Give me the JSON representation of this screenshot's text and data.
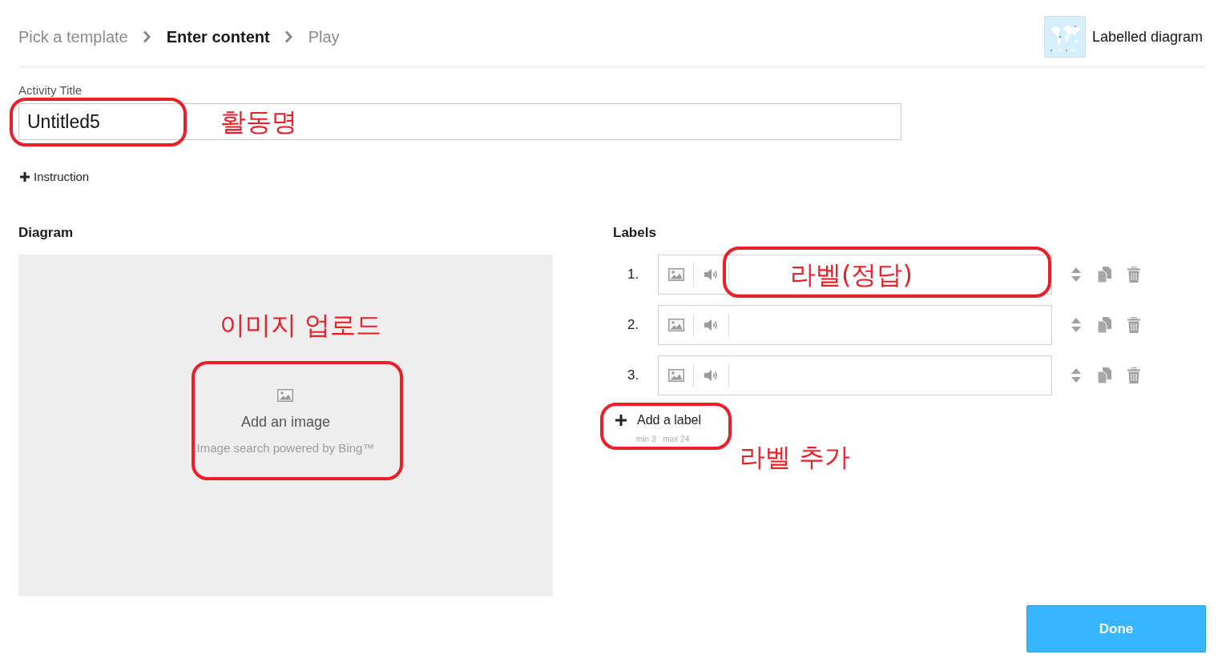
{
  "breadcrumb": [
    {
      "label": "Pick a template",
      "selected": false
    },
    {
      "label": "Enter content",
      "selected": true
    },
    {
      "label": "Play",
      "selected": false
    }
  ],
  "template": {
    "name": "Labelled diagram"
  },
  "activity_title": {
    "label": "Activity Title",
    "value": "Untitled5",
    "highlighted": true,
    "annotation": "활동명"
  },
  "instruction": {
    "label": "Instruction"
  },
  "diagram": {
    "heading": "Diagram",
    "annotation": "이미지 업로드",
    "upload": {
      "label": "Add an image",
      "note": "Image search powered by Bing™",
      "highlighted": true
    }
  },
  "labels": {
    "heading": "Labels",
    "items": [
      {
        "number": "1.",
        "highlighted": true,
        "annotation": "라벨(정답)"
      },
      {
        "number": "2.",
        "highlighted": false
      },
      {
        "number": "3.",
        "highlighted": false
      }
    ]
  },
  "add_label": {
    "label": "Add a label",
    "min": "min 3",
    "max": "max 24",
    "highlighted": true,
    "annotation": "라벨 추가"
  },
  "done_button": {
    "label": "Done"
  }
}
